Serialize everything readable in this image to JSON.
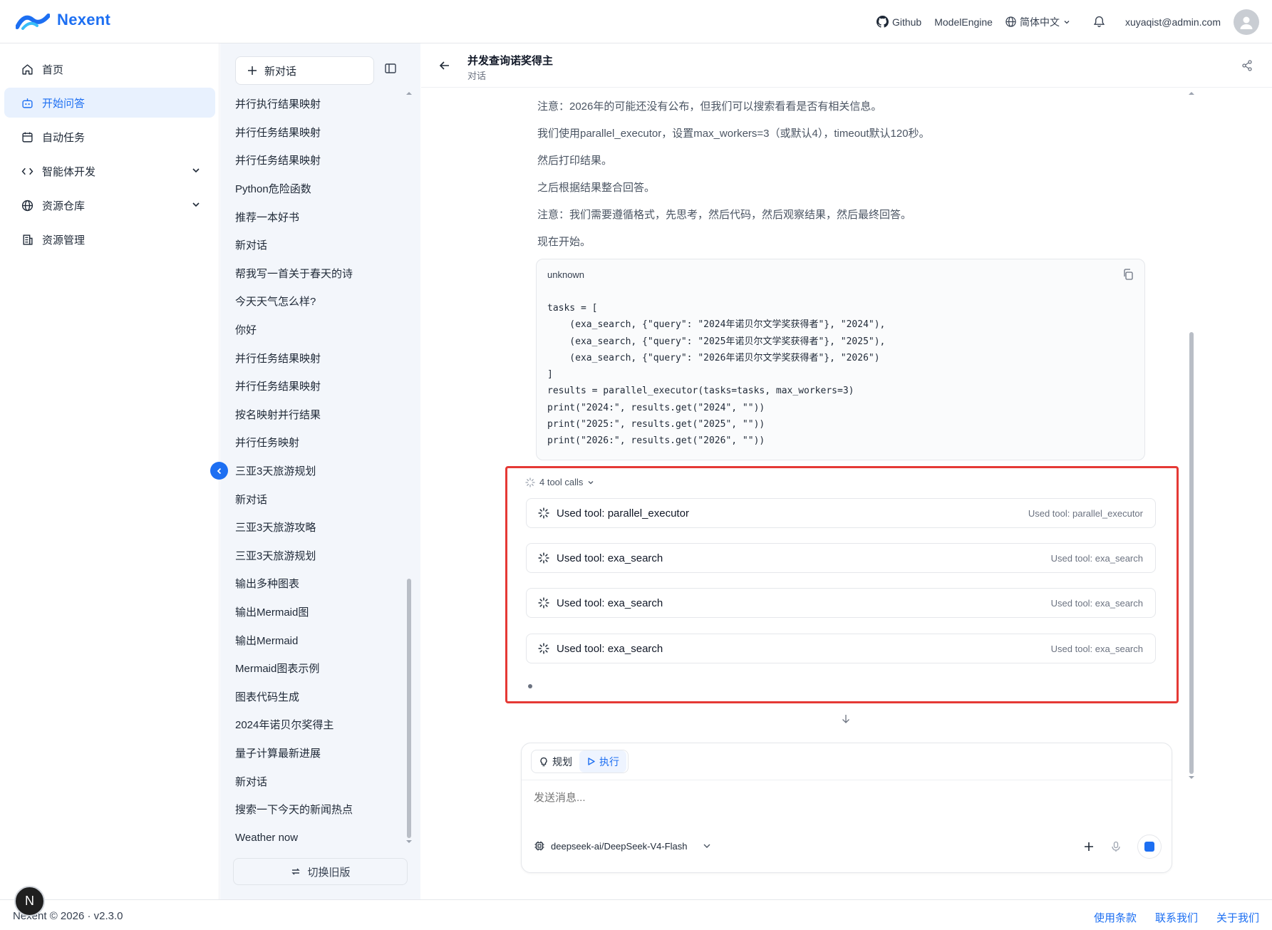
{
  "app": {
    "name": "Nexent",
    "brand_color": "#1d6ff2"
  },
  "topbar": {
    "github": "Github",
    "model_engine": "ModelEngine",
    "language": "简体中文",
    "user_email": "xuyaqist@admin.com"
  },
  "leftnav": {
    "items": [
      {
        "label": "首页",
        "icon": "home-icon"
      },
      {
        "label": "开始问答",
        "icon": "robot-icon",
        "active": true
      },
      {
        "label": "自动任务",
        "icon": "calendar-icon"
      },
      {
        "label": "智能体开发",
        "icon": "code-icon",
        "expandable": true
      },
      {
        "label": "资源仓库",
        "icon": "globe-icon",
        "expandable": true
      },
      {
        "label": "资源管理",
        "icon": "building-icon"
      }
    ]
  },
  "conv_panel": {
    "new_chat": "新对话",
    "items": [
      "并行执行结果映射",
      "并行任务结果映射",
      "并行任务结果映射",
      "Python危险函数",
      "推荐一本好书",
      "新对话",
      "帮我写一首关于春天的诗",
      "今天天气怎么样?",
      "你好",
      "并行任务结果映射",
      "并行任务结果映射",
      "按名映射并行结果",
      "并行任务映射",
      "三亚3天旅游规划",
      "新对话",
      "三亚3天旅游攻略",
      "三亚3天旅游规划",
      "输出多种图表",
      "输出Mermaid图",
      "输出Mermaid",
      "Mermaid图表示例",
      "图表代码生成",
      "2024年诺贝尔奖得主",
      "量子计算最新进展",
      "新对话",
      "搜索一下今天的新闻热点",
      "Weather now"
    ],
    "switch_label": "切换旧版",
    "list_scroll_fraction": 0.35
  },
  "chat": {
    "title": "并发查询诺奖得主",
    "subtitle": "对话",
    "lines": [
      "注意：2026年的可能还没有公布，但我们可以搜索看看是否有相关信息。",
      "我们使用parallel_executor，设置max_workers=3（或默认4），timeout默认120秒。",
      "然后打印结果。",
      "之后根据结果整合回答。",
      "注意：我们需要遵循格式，先思考，然后代码，然后观察结果，然后最终回答。",
      "现在开始。"
    ],
    "code_lang": "unknown",
    "code": "tasks = [\n    (exa_search, {\"query\": \"2024年诺贝尔文学奖获得者\"}, \"2024\"),\n    (exa_search, {\"query\": \"2025年诺贝尔文学奖获得者\"}, \"2025\"),\n    (exa_search, {\"query\": \"2026年诺贝尔文学奖获得者\"}, \"2026\")\n]\nresults = parallel_executor(tasks=tasks, max_workers=3)\nprint(\"2024:\", results.get(\"2024\", \"\"))\nprint(\"2025:\", results.get(\"2025\", \"\"))\nprint(\"2026:\", results.get(\"2026\", \"\"))",
    "tool_calls_label": "4 tool calls",
    "tools": [
      {
        "title": "Used tool: parallel_executor",
        "right": "Used tool: parallel_executor"
      },
      {
        "title": "Used tool: exa_search",
        "right": "Used tool: exa_search"
      },
      {
        "title": "Used tool: exa_search",
        "right": "Used tool: exa_search"
      },
      {
        "title": "Used tool: exa_search",
        "right": "Used tool: exa_search"
      }
    ],
    "highlight_color": "#e53935"
  },
  "composer": {
    "mode_plan": "规划",
    "mode_execute": "执行",
    "placeholder": "发送消息...",
    "model": "deepseek-ai/DeepSeek-V4-Flash"
  },
  "footer": {
    "copyright": "Nexent © 2026 · v2.3.0",
    "links": [
      "使用条款",
      "联系我们",
      "关于我们"
    ],
    "badge": "N"
  }
}
